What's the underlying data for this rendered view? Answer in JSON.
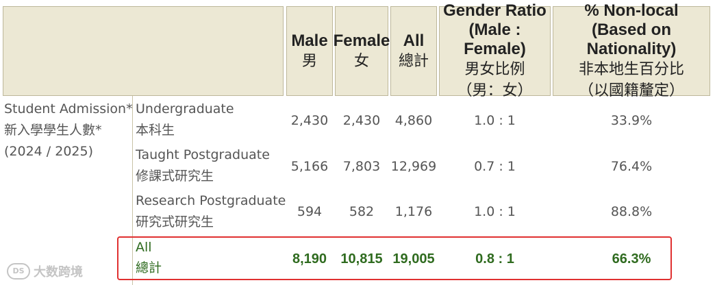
{
  "header": {
    "male_en": "Male",
    "male_zh": "男",
    "female_en": "Female",
    "female_zh": "女",
    "all_en": "All",
    "all_zh": "總計",
    "ratio_en_1": "Gender Ratio",
    "ratio_en_2": "(Male : Female)",
    "ratio_zh_1": "男女比例",
    "ratio_zh_2": "（男：女）",
    "nonlocal_en_1": "% Non-local",
    "nonlocal_en_2": "(Based on Nationality)",
    "nonlocal_zh_1": "非本地生百分比",
    "nonlocal_zh_2": "（以國籍釐定）"
  },
  "group": {
    "label_en": "Student Admission*",
    "label_zh": "新入學學生人數*",
    "year": "(2024 / 2025)"
  },
  "rows": [
    {
      "label_en": "Undergraduate",
      "label_zh": "本科生",
      "male": "2,430",
      "female": "2,430",
      "all": "4,860",
      "ratio": "1.0 : 1",
      "nonlocal": "33.9%"
    },
    {
      "label_en": "Taught Postgraduate",
      "label_zh": "修課式研究生",
      "male": "5,166",
      "female": "7,803",
      "all": "12,969",
      "ratio": "0.7 : 1",
      "nonlocal": "76.4%"
    },
    {
      "label_en": "Research Postgraduate",
      "label_zh": "研究式研究生",
      "male": "594",
      "female": "582",
      "all": "1,176",
      "ratio": "1.0 : 1",
      "nonlocal": "88.8%"
    }
  ],
  "total": {
    "label_en": "All",
    "label_zh": "總計",
    "male": "8,190",
    "female": "10,815",
    "all": "19,005",
    "ratio": "0.8 : 1",
    "nonlocal": "66.3%"
  },
  "watermark": {
    "logo_text": "DS",
    "text": "大数跨境"
  },
  "colors": {
    "header_bg": "#ece8d4",
    "total_text": "#2f6b1f",
    "highlight_border": "#e03030"
  }
}
